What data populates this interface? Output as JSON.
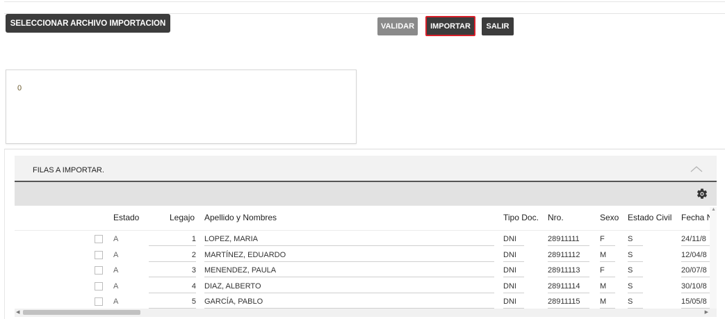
{
  "toolbar": {
    "select_file": "SELECCIONAR ARCHIVO IMPORTACION",
    "validate": "VALIDAR",
    "import": "IMPORTAR",
    "exit": "SALIR"
  },
  "log": {
    "text": "0"
  },
  "panel": {
    "title": "FILAS A IMPORTAR.",
    "collapse_icon": "chevron-up-icon",
    "settings_icon": "gear-icon"
  },
  "table": {
    "headers": {
      "estado": "Estado",
      "legajo": "Legajo",
      "nombre": "Apellido y Nombres",
      "tipo": "Tipo Doc.",
      "nro": "Nro.",
      "sexo": "Sexo",
      "civil": "Estado Civil",
      "fecha": "Fecha N"
    },
    "rows": [
      {
        "estado": "A",
        "legajo": "1",
        "nombre": "LOPEZ, MARIA",
        "tipo": "DNI",
        "nro": "28911111",
        "sexo": "F",
        "civil": "S",
        "fecha": "24/11/8"
      },
      {
        "estado": "A",
        "legajo": "2",
        "nombre": "MARTÍNEZ, EDUARDO",
        "tipo": "DNI",
        "nro": "28911112",
        "sexo": "M",
        "civil": "S",
        "fecha": "12/04/8"
      },
      {
        "estado": "A",
        "legajo": "3",
        "nombre": "MENENDEZ, PAULA",
        "tipo": "DNI",
        "nro": "28911113",
        "sexo": "F",
        "civil": "S",
        "fecha": "20/07/8"
      },
      {
        "estado": "A",
        "legajo": "4",
        "nombre": "DIAZ, ALBERTO",
        "tipo": "DNI",
        "nro": "28911114",
        "sexo": "M",
        "civil": "S",
        "fecha": "30/10/8"
      },
      {
        "estado": "A",
        "legajo": "5",
        "nombre": "GARCÍA, PABLO",
        "tipo": "DNI",
        "nro": "28911115",
        "sexo": "M",
        "civil": "S",
        "fecha": "15/05/8"
      }
    ]
  },
  "colors": {
    "button_dark": "#3c3c3c",
    "button_disabled": "#8a8a8a",
    "focus_border": "#d81f2a"
  }
}
